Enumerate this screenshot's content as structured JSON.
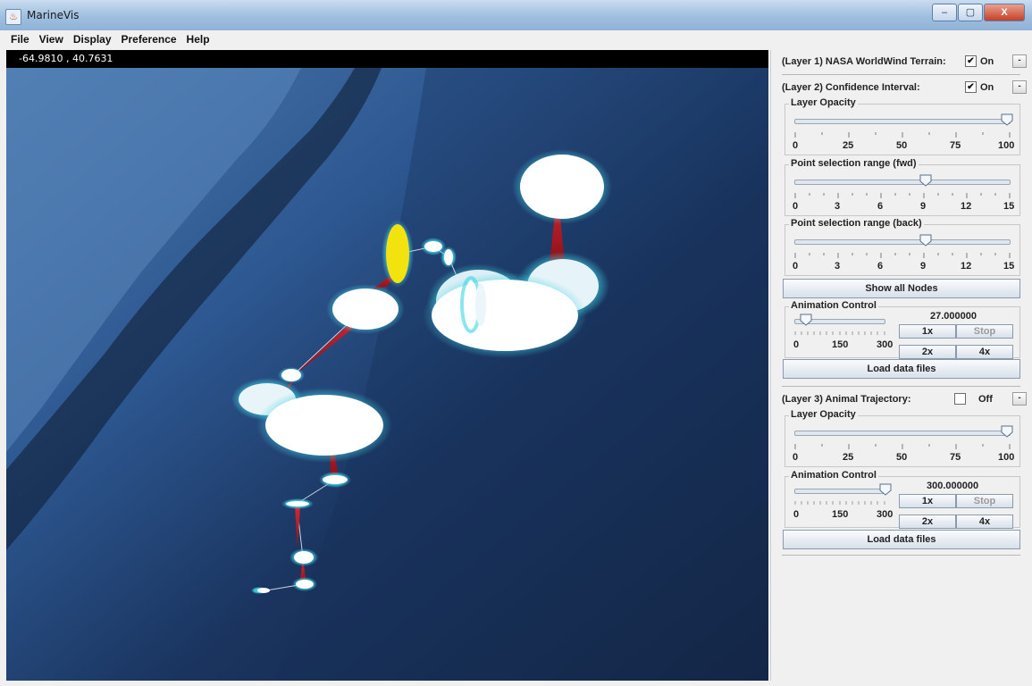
{
  "window": {
    "title": "MarineVis",
    "controls": [
      "–",
      "▢",
      "X"
    ]
  },
  "menu": [
    "File",
    "View",
    "Display",
    "Preference",
    "Help"
  ],
  "globe": {
    "coordinates": "-64.9810 , 40.7631"
  },
  "layer1": {
    "label": "(Layer 1) NASA WorldWind Terrain:",
    "check": "✔",
    "state": "On",
    "collapse": "-"
  },
  "layer2": {
    "label": "(Layer 2) Confidence Interval:",
    "check": "✔",
    "state": "On",
    "collapse": "-",
    "opacity": {
      "title": "Layer Opacity",
      "ticks": [
        "0",
        "25",
        "50",
        "75",
        "100"
      ],
      "value": 100
    },
    "fwd": {
      "title": "Point selection range (fwd)",
      "ticks": [
        "0",
        "3",
        "6",
        "9",
        "12",
        "15"
      ],
      "value": 9
    },
    "back": {
      "title": "Point selection range (back)",
      "ticks": [
        "0",
        "3",
        "6",
        "9",
        "12",
        "15"
      ],
      "value": 9
    },
    "show_all": "Show all Nodes",
    "animation": {
      "title": "Animation Control",
      "value_text": "27.000000",
      "value": 27,
      "ticks": [
        "0",
        "150",
        "300"
      ],
      "btn_1x": "1x",
      "btn_stop": "Stop",
      "btn_2x": "2x",
      "btn_4x": "4x"
    },
    "load": "Load data files"
  },
  "layer3": {
    "label": "(Layer 3) Animal Trajectory:",
    "check": "",
    "state": "Off",
    "collapse": "-",
    "opacity": {
      "title": "Layer Opacity",
      "ticks": [
        "0",
        "25",
        "50",
        "75",
        "100"
      ],
      "value": 100
    },
    "animation": {
      "title": "Animation Control",
      "value_text": "300.000000",
      "value": 300,
      "ticks": [
        "0",
        "150",
        "300"
      ],
      "btn_1x": "1x",
      "btn_stop": "Stop",
      "btn_2x": "2x",
      "btn_4x": "4x"
    },
    "load": "Load data files"
  },
  "colors": {
    "glow": "#3fd6e6",
    "ellipse": "#ffffff",
    "cone": "#c0202a",
    "selected": "#f2e20e"
  }
}
